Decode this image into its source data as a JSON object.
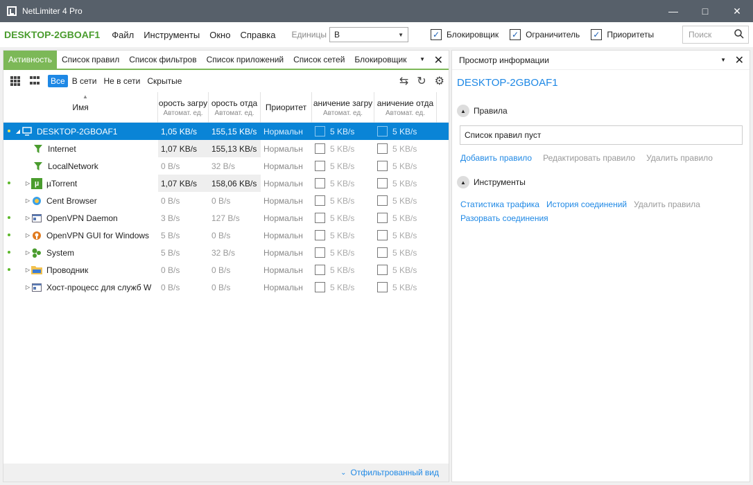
{
  "window": {
    "title": "NetLimiter 4 Pro"
  },
  "menubar": {
    "machine": "DESKTOP-2GBOAF1",
    "menu": [
      "Файл",
      "Инструменты",
      "Окно",
      "Справка"
    ],
    "units_label": "Единицы",
    "units_value": "B",
    "checks": [
      {
        "label": "Блокировщик",
        "checked": true
      },
      {
        "label": "Ограничитель",
        "checked": true
      },
      {
        "label": "Приоритеты",
        "checked": true
      }
    ],
    "search_placeholder": "Поиск"
  },
  "tabs": [
    "Активность",
    "Список правил",
    "Список фильтров",
    "Список приложений",
    "Список сетей",
    "Блокировщик"
  ],
  "filters": [
    "Все",
    "В сети",
    "Не в сети",
    "Скрытые"
  ],
  "columns": {
    "name": "Имя",
    "dl": "орость загру",
    "dl_sub": "Автомат. ед.",
    "ul": "орость отда",
    "ul_sub": "Автомат. ед.",
    "priority": "Приоритет",
    "lim_dl": "аничение загру",
    "lim_dl_sub": "Автомат. ед.",
    "lim_ul": "аничение отда",
    "lim_ul_sub": "Автомат. ед."
  },
  "rows": [
    {
      "name": "DESKTOP-2GBOAF1",
      "dl": "1,05 KB/s",
      "ul": "155,15 KB/s",
      "priority": "Нормальн",
      "lim_dl": "5 KB/s",
      "lim_ul": "5 KB/s"
    },
    {
      "name": "Internet",
      "dl": "1,07 KB/s",
      "ul": "155,13 KB/s",
      "priority": "Нормальн",
      "lim_dl": "5 KB/s",
      "lim_ul": "5 KB/s"
    },
    {
      "name": "LocalNetwork",
      "dl": "0 B/s",
      "ul": "32 B/s",
      "priority": "Нормальн",
      "lim_dl": "5 KB/s",
      "lim_ul": "5 KB/s"
    },
    {
      "name": "µTorrent",
      "dl": "1,07 KB/s",
      "ul": "158,06 KB/s",
      "priority": "Нормальн",
      "lim_dl": "5 KB/s",
      "lim_ul": "5 KB/s"
    },
    {
      "name": "Cent Browser",
      "dl": "0 B/s",
      "ul": "0 B/s",
      "priority": "Нормальн",
      "lim_dl": "5 KB/s",
      "lim_ul": "5 KB/s"
    },
    {
      "name": "OpenVPN Daemon",
      "dl": "3 B/s",
      "ul": "127 B/s",
      "priority": "Нормальн",
      "lim_dl": "5 KB/s",
      "lim_ul": "5 KB/s"
    },
    {
      "name": "OpenVPN GUI for Windows",
      "dl": "5 B/s",
      "ul": "0 B/s",
      "priority": "Нормальн",
      "lim_dl": "5 KB/s",
      "lim_ul": "5 KB/s"
    },
    {
      "name": "System",
      "dl": "5 B/s",
      "ul": "32 B/s",
      "priority": "Нормальн",
      "lim_dl": "5 KB/s",
      "lim_ul": "5 KB/s"
    },
    {
      "name": "Проводник",
      "dl": "0 B/s",
      "ul": "0 B/s",
      "priority": "Нормальн",
      "lim_dl": "5 KB/s",
      "lim_ul": "5 KB/s"
    },
    {
      "name": "Хост-процесс для служб W",
      "dl": "0 B/s",
      "ul": "0 B/s",
      "priority": "Нормальн",
      "lim_dl": "5 KB/s",
      "lim_ul": "5 KB/s"
    }
  ],
  "bottom": {
    "label": "Отфильтрованный вид"
  },
  "info": {
    "header": "Просмотр информации",
    "title": "DESKTOP-2GBOAF1",
    "rules_section": "Правила",
    "rules_empty": "Список правил пуст",
    "rule_actions": [
      "Добавить правило",
      "Редактировать правило",
      "Удалить правило"
    ],
    "tools_section": "Инструменты",
    "tool_actions": [
      "Статистика трафика",
      "История соединений",
      "Удалить правила",
      "Разорвать соединения"
    ]
  },
  "colors": {
    "accent_green": "#7cb857",
    "selection_blue": "#0a84d6",
    "link_blue": "#1e88e5",
    "titlebar": "#57606a"
  }
}
